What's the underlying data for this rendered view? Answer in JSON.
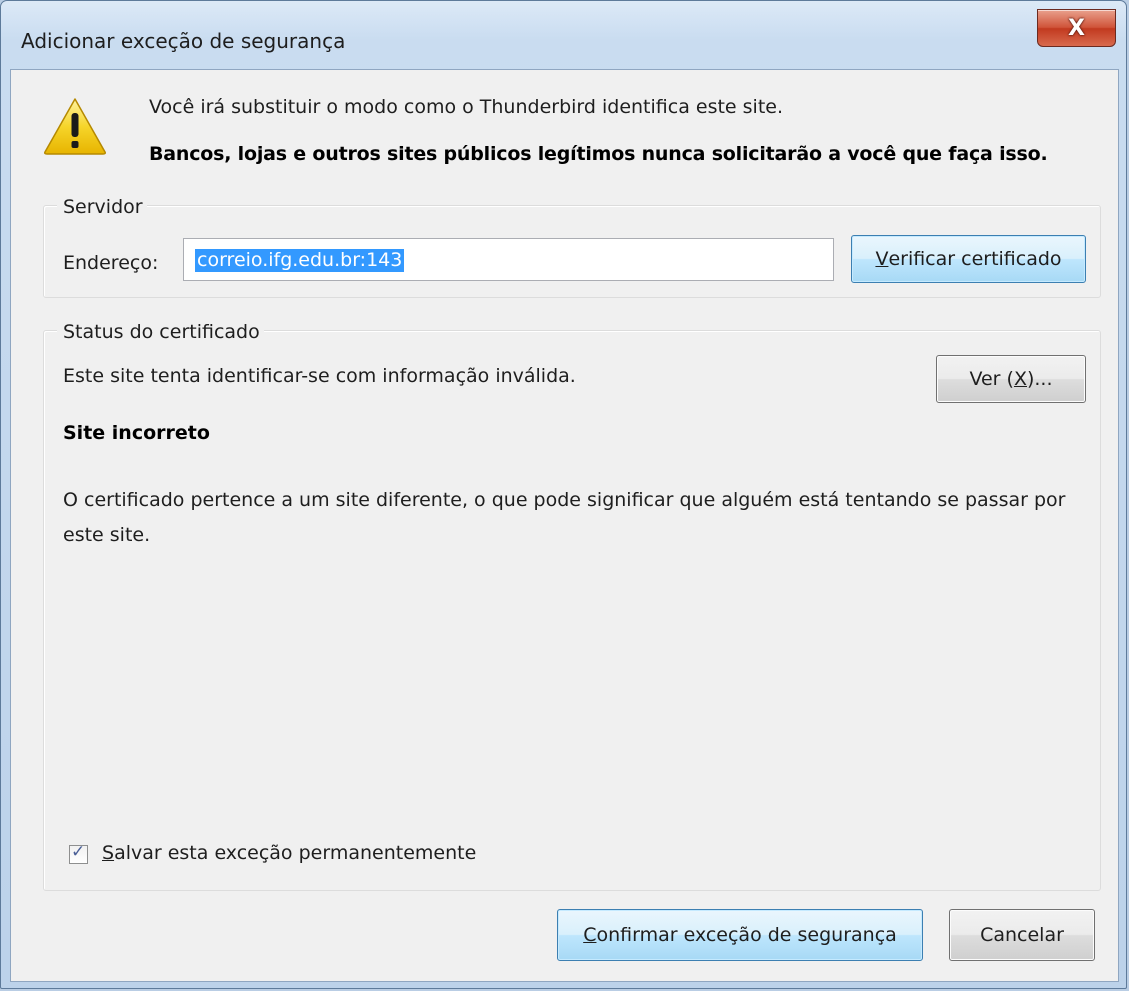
{
  "window": {
    "title": "Adicionar exceção de segurança",
    "close_glyph": "X"
  },
  "warning": {
    "icon": "warning-triangle-icon",
    "line1": "Você irá substituir o modo como o Thunderbird identifica este site.",
    "line2": "Bancos, lojas e outros sites públicos legítimos nunca solicitarão a você que faça isso."
  },
  "server": {
    "group_label": "Servidor",
    "address_label": "Endereço:",
    "address_value": "correio.ifg.edu.br:143",
    "verify_button": {
      "mnemonic": "V",
      "rest": "erificar certificado"
    }
  },
  "status": {
    "group_label": "Status do certificado",
    "line": "Este site tenta identificar-se com informação inválida.",
    "view_button": {
      "before": "Ver (",
      "mnemonic": "X",
      "after": ")..."
    },
    "title": "Site incorreto",
    "description": "O certificado pertence a um site diferente, o que pode significar que alguém está tentando se passar por este site."
  },
  "permanent": {
    "checked": true,
    "mnemonic": "S",
    "rest": "alvar esta exceção permanentemente"
  },
  "buttons": {
    "confirm": {
      "mnemonic": "C",
      "rest": "onfirmar exceção de segurança"
    },
    "cancel": "Cancelar"
  },
  "colors": {
    "selection": "#3399ff",
    "close_button": "#c23a20",
    "warning_yellow": "#f5d21c"
  }
}
